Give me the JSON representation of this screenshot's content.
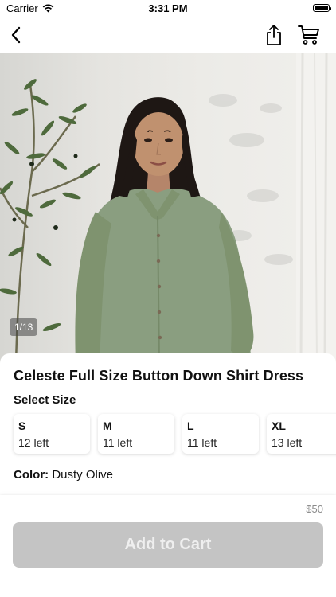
{
  "status_bar": {
    "carrier": "Carrier",
    "time": "3:31 PM"
  },
  "nav": {
    "icons": [
      "chevron-left-icon",
      "share-icon",
      "cart-icon"
    ]
  },
  "gallery": {
    "counter": "1/13"
  },
  "product": {
    "title": "Celeste Full Size Button Down Shirt Dress",
    "select_size_label": "Select Size",
    "sizes": [
      {
        "size": "S",
        "stock": "12 left"
      },
      {
        "size": "M",
        "stock": "11 left"
      },
      {
        "size": "L",
        "stock": "11 left"
      },
      {
        "size": "XL",
        "stock": "13 left"
      }
    ],
    "color_label": "Color:",
    "color_value": "Dusty Olive"
  },
  "footer": {
    "price": "$50",
    "add_to_cart_label": "Add to Cart"
  },
  "colors": {
    "button_disabled": "#c4c4c4",
    "dress": "#8a9e80"
  }
}
